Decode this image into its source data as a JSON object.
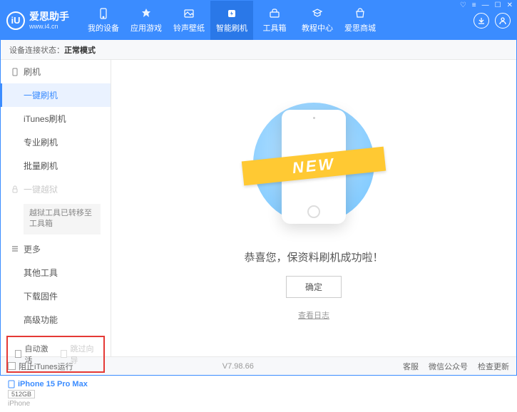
{
  "header": {
    "logoLetter": "iU",
    "title": "爱思助手",
    "subtitle": "www.i4.cn",
    "nav": [
      {
        "label": "我的设备"
      },
      {
        "label": "应用游戏"
      },
      {
        "label": "铃声壁纸"
      },
      {
        "label": "智能刷机"
      },
      {
        "label": "工具箱"
      },
      {
        "label": "教程中心"
      },
      {
        "label": "爱思商城"
      }
    ]
  },
  "subheader": {
    "prefix": "设备连接状态：",
    "status": "正常模式"
  },
  "sidebar": {
    "sec1": "刷机",
    "items1": [
      "一键刷机",
      "iTunes刷机",
      "专业刷机",
      "批量刷机"
    ],
    "sec2": "一键越狱",
    "jailbreakNote": "越狱工具已转移至工具箱",
    "sec3": "更多",
    "items3": [
      "其他工具",
      "下载固件",
      "高级功能"
    ],
    "checkbox1": "自动激活",
    "checkbox2": "跳过向导",
    "deviceName": "iPhone 15 Pro Max",
    "deviceStorage": "512GB",
    "deviceType": "iPhone"
  },
  "content": {
    "ribbon": "NEW",
    "message": "恭喜您，保资料刷机成功啦！",
    "okBtn": "确定",
    "logLink": "查看日志"
  },
  "statusbar": {
    "blockItunes": "阻止iTunes运行",
    "version": "V7.98.66",
    "links": [
      "客服",
      "微信公众号",
      "检查更新"
    ]
  }
}
